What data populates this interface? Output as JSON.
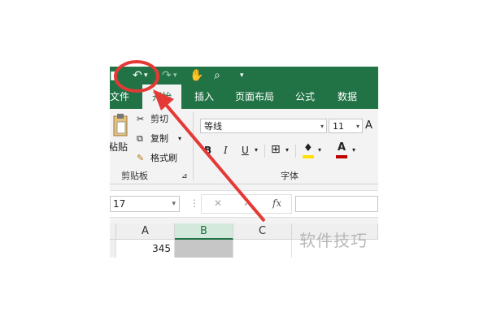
{
  "qat": {
    "undo_icon": "undo-arrow",
    "redo_icon": "redo-arrow",
    "touch_mode_icon": "hand-touch",
    "print_preview_icon": "print-preview",
    "dropdown_glyph": "▾"
  },
  "tabs": [
    {
      "label": "文件",
      "active": false
    },
    {
      "label": "开始",
      "active": true
    },
    {
      "label": "插入",
      "active": false
    },
    {
      "label": "页面布局",
      "active": false
    },
    {
      "label": "公式",
      "active": false
    },
    {
      "label": "数据",
      "active": false
    }
  ],
  "clipboard": {
    "paste_label": "粘贴",
    "cut_label": "剪切",
    "copy_label": "复制",
    "format_painter_label": "格式刷",
    "group_label": "剪贴板"
  },
  "font": {
    "family": "等线",
    "size": "11",
    "grow_glyph": "A",
    "bold": "B",
    "italic": "I",
    "underline": "U",
    "font_color_glyph": "A",
    "group_label": "字体",
    "accent_color": "#c00000",
    "highlight_color": "#ffe000"
  },
  "formula_bar": {
    "name_box": "17",
    "cancel_glyph": "✕",
    "enter_glyph": "✓",
    "fx_label": "fx"
  },
  "sheet": {
    "columns": [
      {
        "label": "A",
        "selected": false
      },
      {
        "label": "B",
        "selected": true
      },
      {
        "label": "C",
        "selected": false
      }
    ],
    "row1": {
      "A": "345",
      "B": "",
      "C": ""
    }
  },
  "watermark": "软件技巧",
  "colors": {
    "excel_green": "#217346",
    "annotation_red": "#e53935"
  }
}
